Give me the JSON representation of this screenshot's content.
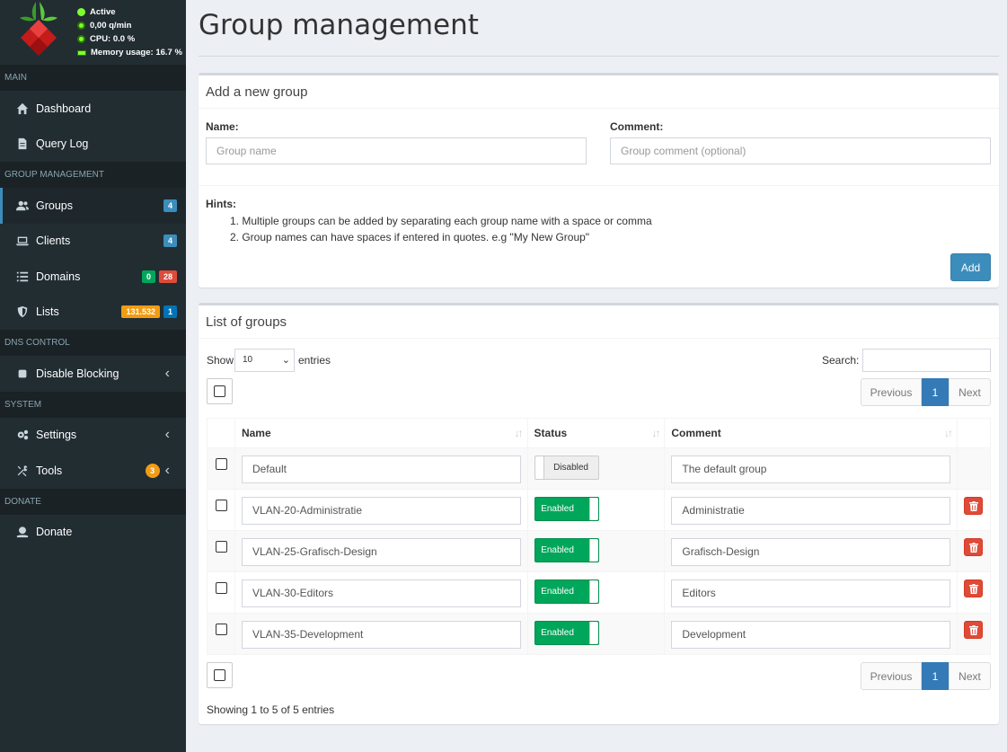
{
  "status": {
    "active": "Active",
    "queries": "0,00 q/min",
    "cpu": "CPU: 0.0 %",
    "memory": "Memory usage: 16.7 %"
  },
  "sidebar": {
    "sections": {
      "main": "MAIN",
      "group_management": "GROUP MANAGEMENT",
      "dns_control": "DNS CONTROL",
      "system": "SYSTEM",
      "donate": "DONATE"
    },
    "items": {
      "dashboard": "Dashboard",
      "query_log": "Query Log",
      "groups": "Groups",
      "groups_badge": "4",
      "clients": "Clients",
      "clients_badge": "4",
      "domains": "Domains",
      "domains_badge_allow": "0",
      "domains_badge_deny": "28",
      "lists": "Lists",
      "lists_badge_domains": "131.532",
      "lists_badge_count": "1",
      "disable_blocking": "Disable Blocking",
      "settings": "Settings",
      "tools": "Tools",
      "tools_badge": "3",
      "donate": "Donate"
    }
  },
  "page": {
    "title": "Group management"
  },
  "add_group": {
    "header": "Add a new group",
    "name_label": "Name:",
    "name_placeholder": "Group name",
    "comment_label": "Comment:",
    "comment_placeholder": "Group comment (optional)",
    "hints_title": "Hints:",
    "hints": [
      "Multiple groups can be added by separating each group name with a space or comma",
      "Group names can have spaces if entered in quotes. e.g \"My New Group\""
    ],
    "add_button": "Add"
  },
  "group_list": {
    "header": "List of groups",
    "show_label": "Show",
    "entries_value": "10",
    "entries_label": "entries",
    "search_label": "Search:",
    "columns": {
      "name": "Name",
      "status": "Status",
      "comment": "Comment"
    },
    "rows": [
      {
        "name": "Default",
        "status": "Disabled",
        "comment": "The default group"
      },
      {
        "name": "VLAN-20-Administratie",
        "status": "Enabled",
        "comment": "Administratie"
      },
      {
        "name": "VLAN-25-Grafisch-Design",
        "status": "Enabled",
        "comment": "Grafisch-Design"
      },
      {
        "name": "VLAN-30-Editors",
        "status": "Enabled",
        "comment": "Editors"
      },
      {
        "name": "VLAN-35-Development",
        "status": "Enabled",
        "comment": "Development"
      }
    ],
    "pagination": {
      "previous": "Previous",
      "current": "1",
      "next": "Next"
    },
    "footer_info": "Showing 1 to 5 of 5 entries"
  }
}
